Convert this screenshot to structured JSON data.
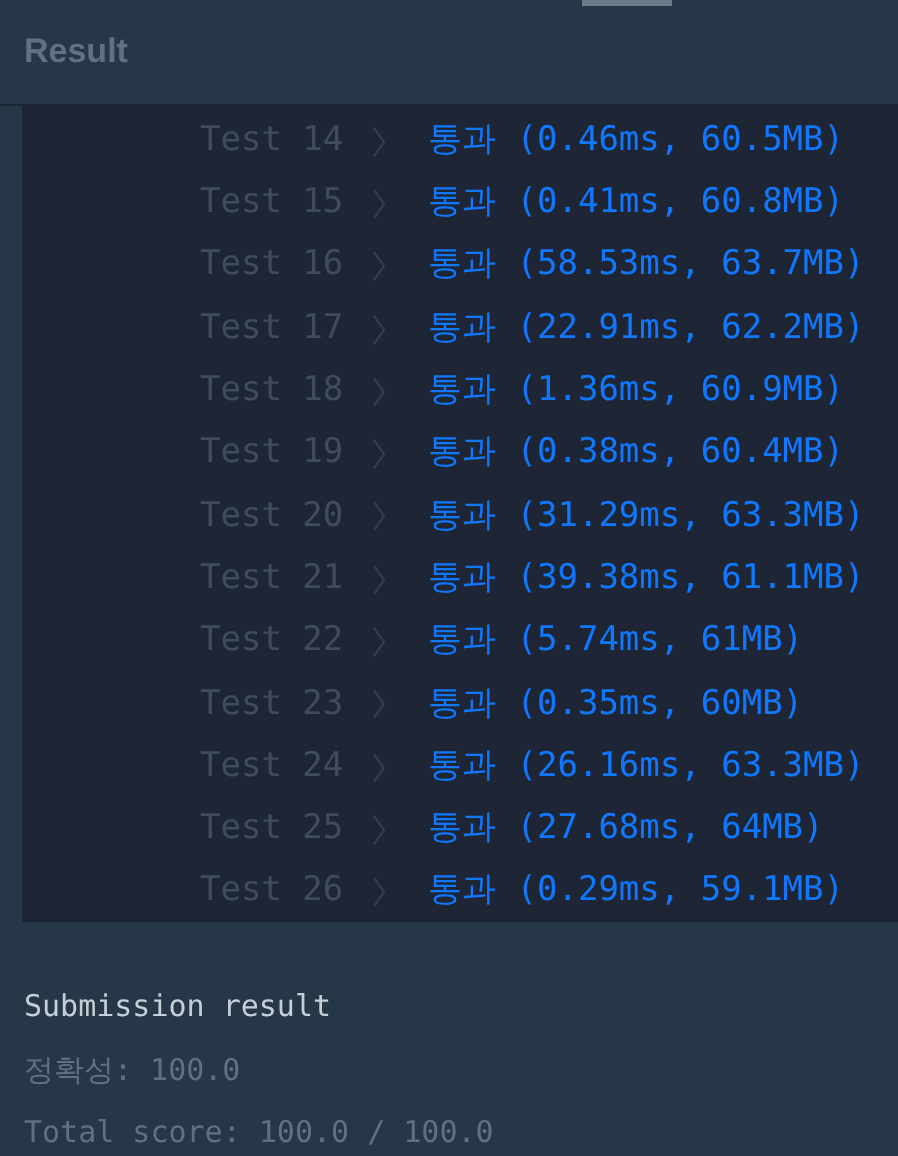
{
  "header": {
    "title": "Result"
  },
  "tests": [
    {
      "label": "Test 14",
      "status": "통과",
      "detail": "(0.46ms, 60.5MB)"
    },
    {
      "label": "Test 15",
      "status": "통과",
      "detail": "(0.41ms, 60.8MB)"
    },
    {
      "label": "Test 16",
      "status": "통과",
      "detail": "(58.53ms, 63.7MB)"
    },
    {
      "label": "Test 17",
      "status": "통과",
      "detail": "(22.91ms, 62.2MB)"
    },
    {
      "label": "Test 18",
      "status": "통과",
      "detail": "(1.36ms, 60.9MB)"
    },
    {
      "label": "Test 19",
      "status": "통과",
      "detail": "(0.38ms, 60.4MB)"
    },
    {
      "label": "Test 20",
      "status": "통과",
      "detail": "(31.29ms, 63.3MB)"
    },
    {
      "label": "Test 21",
      "status": "통과",
      "detail": "(39.38ms, 61.1MB)"
    },
    {
      "label": "Test 22",
      "status": "통과",
      "detail": "(5.74ms, 61MB)"
    },
    {
      "label": "Test 23",
      "status": "통과",
      "detail": "(0.35ms, 60MB)"
    },
    {
      "label": "Test 24",
      "status": "통과",
      "detail": "(26.16ms, 63.3MB)"
    },
    {
      "label": "Test 25",
      "status": "통과",
      "detail": "(27.68ms, 64MB)"
    },
    {
      "label": "Test 26",
      "status": "통과",
      "detail": "(0.29ms, 59.1MB)"
    }
  ],
  "summary": {
    "title": "Submission result",
    "accuracy": "정확성: 100.0",
    "total": "Total score: 100.0 / 100.0"
  }
}
